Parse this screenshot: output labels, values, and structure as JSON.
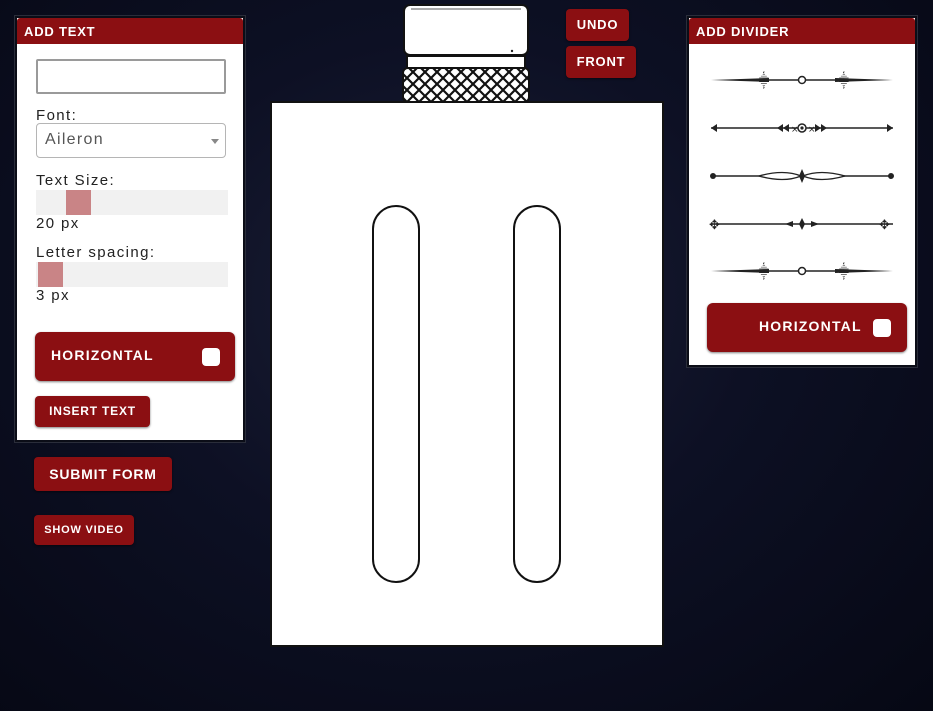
{
  "add_text": {
    "header": "ADD TEXT",
    "text_input_value": "",
    "font_label": "Font:",
    "font_selected": "Aileron",
    "size_label": "Text Size:",
    "size_value": "20 px",
    "spacing_label": "Letter spacing:",
    "spacing_value": "3 px",
    "horizontal_label": "HORIZONTAL",
    "insert_label": "INSERT TEXT"
  },
  "submit_label": "SUBMIT FORM",
  "video_label": "SHOW VIDEO",
  "top_buttons": {
    "undo_label": "UNDO",
    "front_label": "FRONT"
  },
  "add_divider": {
    "header": "ADD DIVIDER",
    "horizontal_label": "HORIZONTAL",
    "dividers": [
      "divider-style-1",
      "divider-style-2",
      "divider-style-3",
      "divider-style-4",
      "divider-style-5"
    ]
  },
  "colors": {
    "accent": "#8b0f12",
    "background": "#0d1024",
    "slider_thumb": "#c98486"
  }
}
